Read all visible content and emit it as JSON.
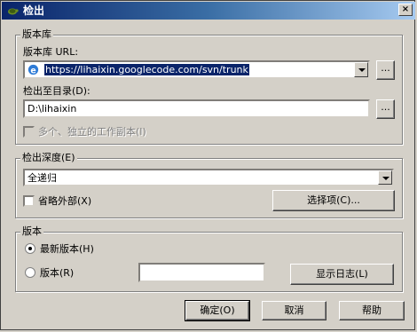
{
  "window": {
    "title": "检出",
    "close_label": "×"
  },
  "repo_group": {
    "title": "版本库",
    "url_label": "版本库 URL:",
    "url_value": "https://lihaixin.googlecode.com/svn/trunk",
    "browse_label": "...",
    "checkout_dir_label": "检出至目录(D):",
    "checkout_dir_value": "D:\\lihaixin",
    "browse_dir_label": "...",
    "multi_copy_label": "多个、独立的工作副本(I)"
  },
  "depth_group": {
    "title": "检出深度(E)",
    "depth_value": "全递归",
    "omit_externals_label": "省略外部(X)",
    "options_label": "选择项(C)..."
  },
  "revision_group": {
    "title": "版本",
    "head_label": "最新版本(H)",
    "revision_label": "版本(R)",
    "revision_value": "",
    "show_log_label": "显示日志(L)"
  },
  "buttons": {
    "ok": "确定(O)",
    "cancel": "取消",
    "help": "帮助"
  }
}
